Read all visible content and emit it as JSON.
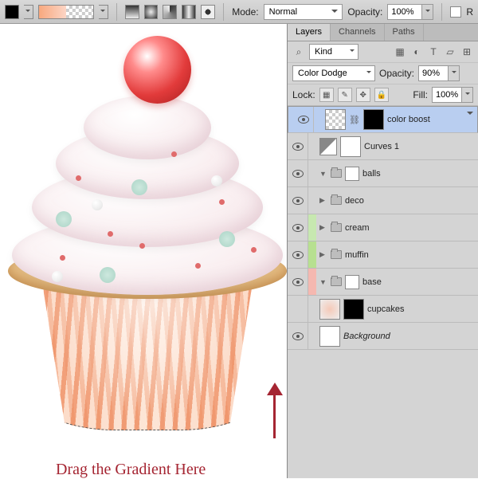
{
  "toolbar": {
    "mode_label": "Mode:",
    "mode_value": "Normal",
    "opacity_label": "Opacity:",
    "opacity_value": "100%",
    "r_label": "R"
  },
  "tabs": {
    "layers": "Layers",
    "channels": "Channels",
    "paths": "Paths"
  },
  "filter": {
    "kind_icon": "⌕",
    "kind_value": "Kind"
  },
  "blend": {
    "mode_value": "Color Dodge",
    "opacity_label": "Opacity:",
    "opacity_value": "90%"
  },
  "lock": {
    "label": "Lock:",
    "fill_label": "Fill:",
    "fill_value": "100%"
  },
  "layers": [
    {
      "name": "color boost",
      "selected": true,
      "type": "layer",
      "color": "",
      "mask": true
    },
    {
      "name": "Curves 1",
      "type": "adjust",
      "color": ""
    },
    {
      "name": "balls",
      "type": "group",
      "color": "",
      "expanded": true
    },
    {
      "name": "deco",
      "type": "group",
      "color": ""
    },
    {
      "name": "cream",
      "type": "group",
      "color": "#c7e8b0"
    },
    {
      "name": "muffin",
      "type": "group",
      "color": "#b7e090"
    },
    {
      "name": "base",
      "type": "group",
      "color": "#f5b8b0",
      "expanded": true
    },
    {
      "name": "cupcakes",
      "type": "smart",
      "color": ""
    },
    {
      "name": "Background",
      "type": "bg",
      "color": "",
      "italic": true
    }
  ],
  "caption": "Drag the Gradient Here"
}
